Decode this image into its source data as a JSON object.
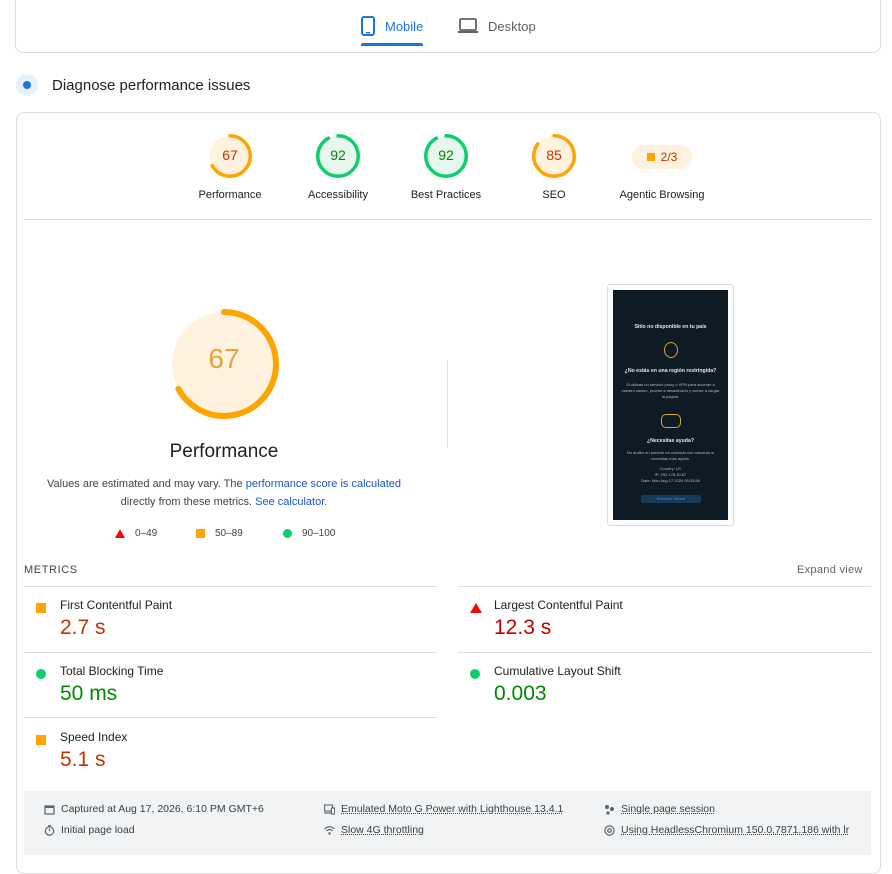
{
  "tabs": {
    "mobile": "Mobile",
    "desktop": "Desktop",
    "active": "mobile"
  },
  "section": {
    "title": "Diagnose performance issues"
  },
  "categories": [
    {
      "label": "Performance",
      "score": "67",
      "value": 67,
      "color": "#ffa400",
      "text_color": "#c33300",
      "bg": "#fff3e0"
    },
    {
      "label": "Accessibility",
      "score": "92",
      "value": 92,
      "color": "#0cce6b",
      "text_color": "#008800",
      "bg": "#e6f7ed"
    },
    {
      "label": "Best Practices",
      "score": "92",
      "value": 92,
      "color": "#0cce6b",
      "text_color": "#008800",
      "bg": "#e6f7ed"
    },
    {
      "label": "SEO",
      "score": "85",
      "value": 85,
      "color": "#ffa400",
      "text_color": "#c33300",
      "bg": "#fff3e0"
    }
  ],
  "agentic": {
    "label": "Agentic Browsing",
    "value": "2/3"
  },
  "performance": {
    "score": "67",
    "value": 67,
    "title": "Performance",
    "note_prefix": "Values are estimated and may vary. The ",
    "note_link1": "performance score is calculated",
    "note_middle": " directly from these metrics. ",
    "note_link2": "See calculator."
  },
  "legend": {
    "fail": "0–49",
    "average": "50–89",
    "pass": "90–100"
  },
  "screenshot": {
    "title": "Sitio no disponible en tu país",
    "q1": "¿No estás en una región restringida?",
    "p1": "Si utilizas un servicio proxy o VPN para acceder a nuestro casino, pruebe a desactivarlo y vuelve a cargar la página.",
    "q2": "¿Necesitas ayuda?",
    "p2": "No dudes en ponerte en contacto con nosotros si necesitas más ayuda.",
    "country": "Country: UY",
    "ip": "IP: 192.178.10.67",
    "date": "Date: Mon Aug 17 2026 05:33:56",
    "button": "Resolver Ahora!"
  },
  "metrics": {
    "heading": "METRICS",
    "expand": "Expand view",
    "items": [
      {
        "name": "First Contentful Paint",
        "value": "2.7 s",
        "rating": "average"
      },
      {
        "name": "Largest Contentful Paint",
        "value": "12.3 s",
        "rating": "fail"
      },
      {
        "name": "Total Blocking Time",
        "value": "50 ms",
        "rating": "pass"
      },
      {
        "name": "Cumulative Layout Shift",
        "value": "0.003",
        "rating": "pass"
      },
      {
        "name": "Speed Index",
        "value": "5.1 s",
        "rating": "average"
      }
    ]
  },
  "footer": {
    "captured": "Captured at Aug 17, 2026, 6:10 PM GMT+6",
    "initial": "Initial page load",
    "emulated": "Emulated Moto G Power with Lighthouse 13.4.1",
    "throttling": "Slow 4G throttling",
    "session": "Single page session",
    "using": "Using HeadlessChromium 150.0.7871.186 with lr"
  },
  "colors": {
    "accent": "#1a73e8",
    "fail": "#eb0f00",
    "average": "#ffa400",
    "pass": "#0cce6b"
  }
}
